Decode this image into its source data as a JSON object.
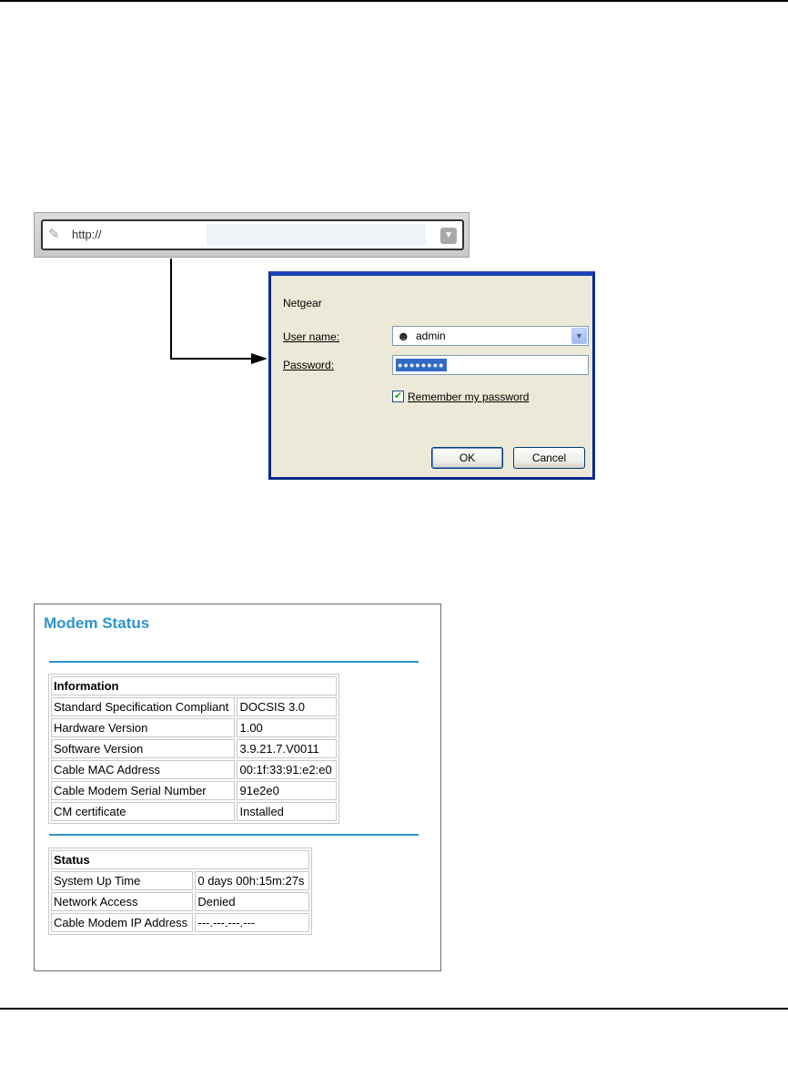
{
  "address_bar": {
    "text": "http://"
  },
  "login_dialog": {
    "realm": "Netgear",
    "username_label": "User name:",
    "username_value": "admin",
    "password_label": "Password:",
    "password_mask": "●●●●●●●●",
    "remember_label": "Remember my password",
    "remember_checked": true,
    "ok_label": "OK",
    "cancel_label": "Cancel"
  },
  "modem_status": {
    "title": "Modem Status",
    "information": {
      "header": "Information",
      "rows": [
        {
          "label": "Standard Specification Compliant",
          "value": "DOCSIS 3.0"
        },
        {
          "label": "Hardware Version",
          "value": "1.00"
        },
        {
          "label": "Software Version",
          "value": "3.9.21.7.V0011"
        },
        {
          "label": "Cable MAC Address",
          "value": "00:1f:33:91:e2:e0"
        },
        {
          "label": "Cable Modem Serial Number",
          "value": "91e2e0"
        },
        {
          "label": "CM certificate",
          "value": "Installed"
        }
      ]
    },
    "status": {
      "header": "Status",
      "rows": [
        {
          "label": "System Up Time",
          "value": "0 days 00h:15m:27s"
        },
        {
          "label": "Network Access",
          "value": "Denied"
        },
        {
          "label": "Cable Modem IP Address",
          "value": "---.---.---.---"
        }
      ]
    }
  },
  "colors": {
    "accent": "#2d93c9",
    "dialog_bg": "#ece9d8",
    "selection": "#316ac5"
  }
}
